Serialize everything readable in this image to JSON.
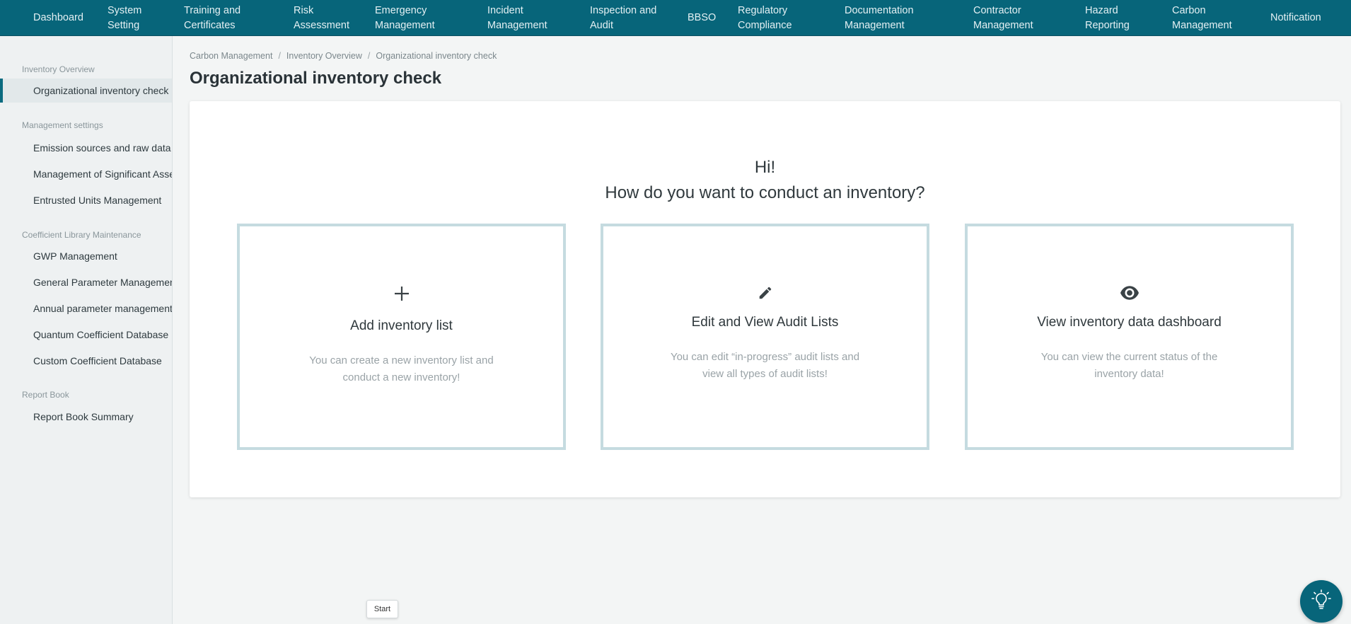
{
  "topnav": {
    "items": [
      {
        "label": "Dashboard"
      },
      {
        "label": "System\nSetting"
      },
      {
        "label": "Training and\nCertificates"
      },
      {
        "label": "Risk\nAssessment"
      },
      {
        "label": "Emergency\nManagement"
      },
      {
        "label": "Incident\nManagement"
      },
      {
        "label": "Inspection and\nAudit"
      },
      {
        "label": "BBSO"
      },
      {
        "label": "Regulatory\nCompliance"
      },
      {
        "label": "Documentation\nManagement"
      },
      {
        "label": "Contractor\nManagement"
      },
      {
        "label": "Hazard\nReporting"
      },
      {
        "label": "Carbon\nManagement"
      },
      {
        "label": "Notification"
      }
    ]
  },
  "sidebar": {
    "groups": [
      {
        "title": "Inventory Overview",
        "items": [
          {
            "label": "Organizational inventory check",
            "active": true
          }
        ]
      },
      {
        "title": "Management settings",
        "items": [
          {
            "label": "Emission sources and raw data m"
          },
          {
            "label": "Management of Significant Asse"
          },
          {
            "label": "Entrusted Units Management"
          }
        ]
      },
      {
        "title": "Coefficient Library Maintenance",
        "items": [
          {
            "label": "GWP Management"
          },
          {
            "label": "General Parameter Managemen"
          },
          {
            "label": "Annual parameter management"
          },
          {
            "label": "Quantum Coefficient Database"
          },
          {
            "label": "Custom Coefficient Database"
          }
        ]
      },
      {
        "title": "Report Book",
        "items": [
          {
            "label": "Report Book Summary"
          }
        ]
      }
    ]
  },
  "breadcrumb": [
    "Carbon Management",
    "Inventory Overview",
    "Organizational inventory check"
  ],
  "breadcrumb_separator": "/",
  "page": {
    "title": "Organizational inventory check",
    "greeting": "Hi!",
    "question": "How do you want to conduct an inventory?"
  },
  "cards": [
    {
      "icon": "plus-icon",
      "title": "Add inventory list",
      "desc": "You can create a new inventory list and conduct a new inventory!"
    },
    {
      "icon": "pencil-icon",
      "title": "Edit and View Audit Lists",
      "desc": "You can edit “in-progress” audit lists and view all types of audit lists!"
    },
    {
      "icon": "eye-icon",
      "title": "View inventory data dashboard",
      "desc": "You can view the current status of the inventory data!"
    }
  ],
  "start_button": "Start",
  "help_button_icon": "lightbulb-icon",
  "colors": {
    "nav_bg": "#07657a",
    "card_border": "#c5dbe0",
    "accent": "#0b6b80"
  }
}
